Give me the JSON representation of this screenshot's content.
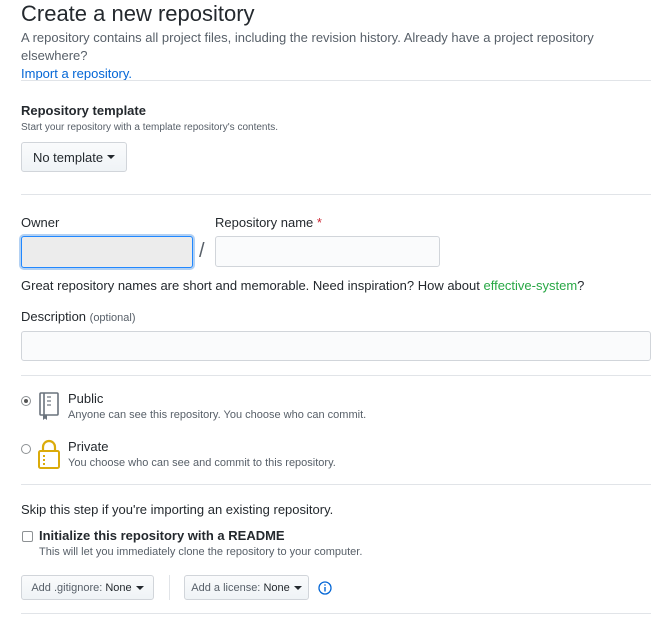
{
  "header": {
    "title": "Create a new repository",
    "subtitle": "A repository contains all project files, including the revision history. Already have a project repository elsewhere?",
    "import_link": "Import a repository."
  },
  "template": {
    "label": "Repository template",
    "note": "Start your repository with a template repository's contents.",
    "button_label": "No template"
  },
  "owner": {
    "label": "Owner",
    "value": ""
  },
  "repo_name": {
    "label": "Repository name",
    "required_mark": "*",
    "value": "",
    "separator": "/"
  },
  "suggestion": {
    "text": "Great repository names are short and memorable. Need inspiration? How about",
    "name": "effective-system",
    "end": "?"
  },
  "description": {
    "label": "Description",
    "optional": "(optional)",
    "value": ""
  },
  "visibility": {
    "public": {
      "title": "Public",
      "desc": "Anyone can see this repository. You choose who can commit.",
      "checked": true
    },
    "private": {
      "title": "Private",
      "desc": "You choose who can see and commit to this repository.",
      "checked": false
    }
  },
  "init": {
    "skip_note": "Skip this step if you're importing an existing repository.",
    "readme_label": "Initialize this repository with a README",
    "readme_desc": "This will let you immediately clone the repository to your computer.",
    "gitignore_label": "Add .gitignore:",
    "gitignore_value": "None",
    "license_label": "Add a license:",
    "license_value": "None"
  },
  "colors": {
    "link": "#0366d6",
    "suggestion": "#28a745",
    "required": "#cb2431",
    "info_icon": "#0366d6"
  }
}
